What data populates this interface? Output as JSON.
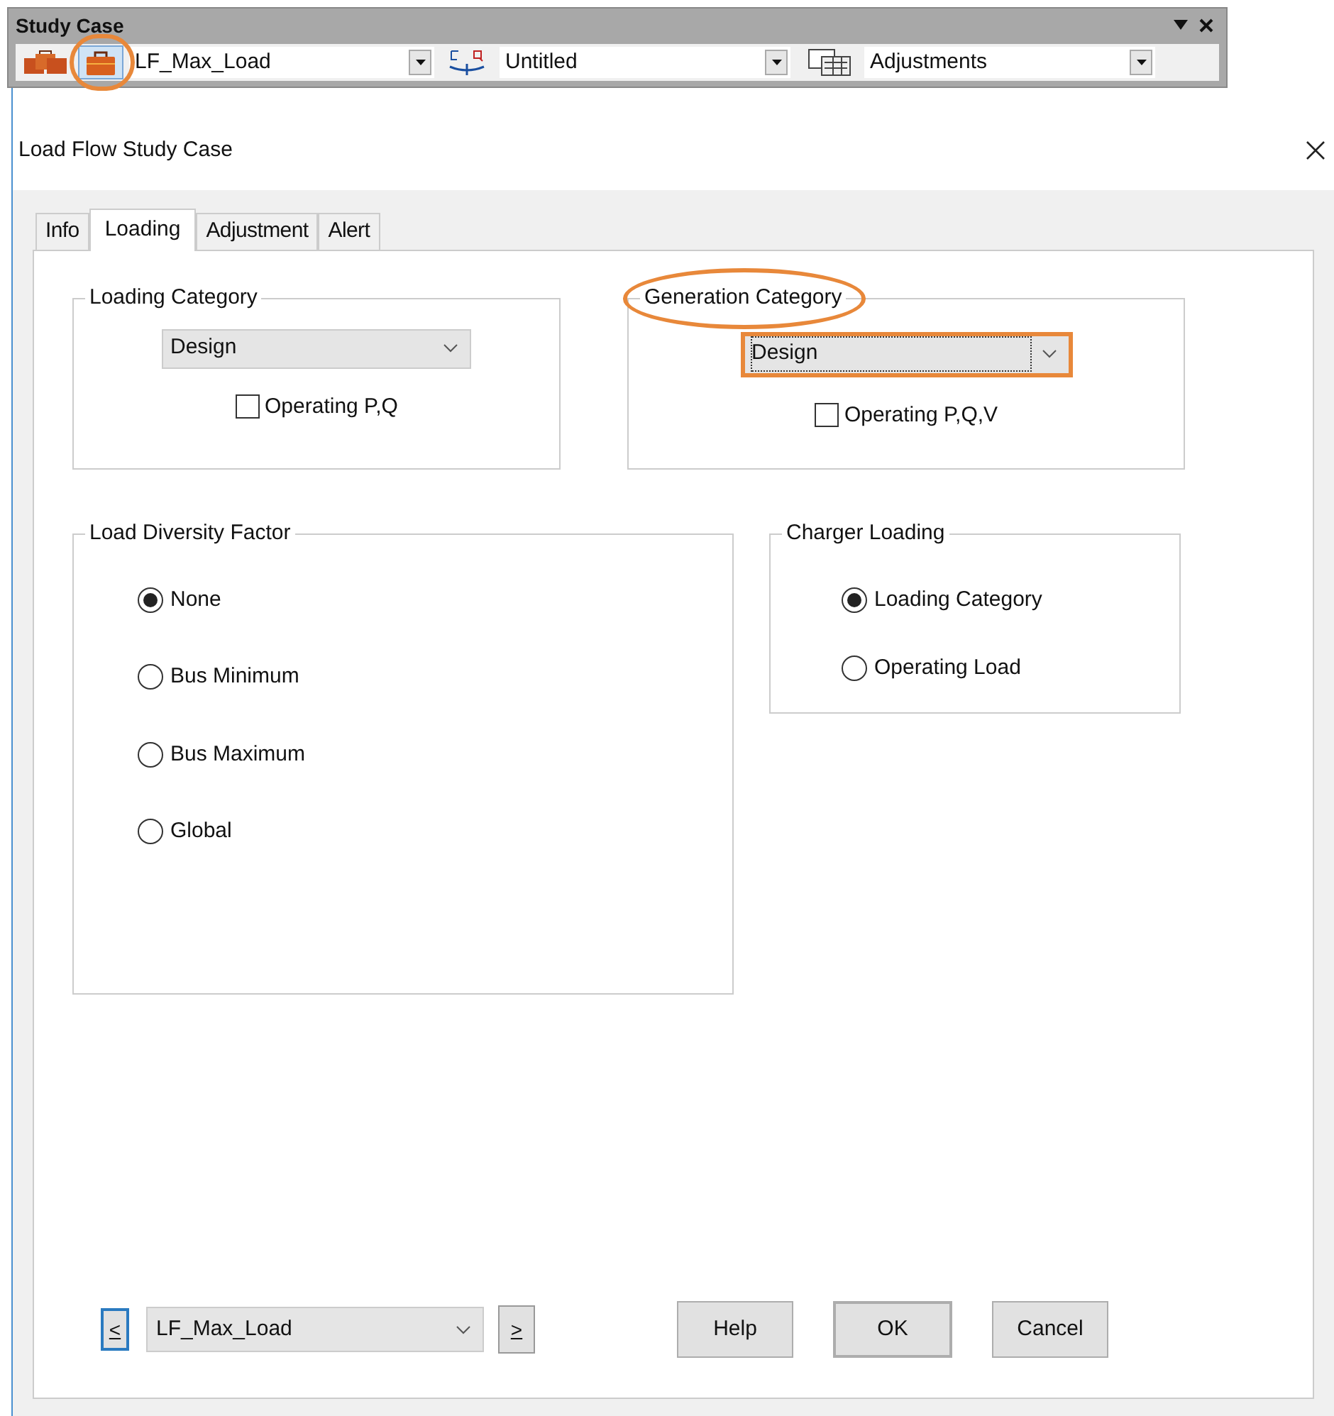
{
  "toolbar": {
    "title": "Study Case",
    "buttons": [
      {
        "kind": "cases",
        "highlighted": false
      },
      {
        "kind": "case",
        "highlighted": true
      }
    ],
    "combos": [
      {
        "kind": "case",
        "value": "LF_Max_Load"
      },
      {
        "kind": "pq",
        "value": "Untitled"
      },
      {
        "kind": "adjust",
        "value": "Adjustments"
      }
    ]
  },
  "dialog": {
    "title": "Load Flow Study Case",
    "tabs": [
      {
        "label": "Info",
        "selected": false
      },
      {
        "label": "Loading",
        "selected": true
      },
      {
        "label": "Adjustment",
        "selected": false
      },
      {
        "label": "Alert",
        "selected": false
      }
    ],
    "loading_category": {
      "title": "Loading Category",
      "highlighted": false,
      "dropdown": {
        "value": "Design",
        "highlighted": false
      },
      "checkbox": {
        "label": "Operating P,Q",
        "checked": false
      }
    },
    "generation_category": {
      "title": "Generation Category",
      "highlighted": true,
      "dropdown": {
        "value": "Design",
        "highlighted": true
      },
      "checkbox": {
        "label": "Operating P,Q,V",
        "checked": false
      }
    },
    "load_diversity_factor": {
      "title": "Load Diversity Factor",
      "options": [
        {
          "label": "None",
          "selected": true
        },
        {
          "label": "Bus Minimum",
          "selected": false
        },
        {
          "label": "Bus Maximum",
          "selected": false
        },
        {
          "label": "Global",
          "selected": false
        }
      ]
    },
    "charger_loading": {
      "title": "Charger Loading",
      "options": [
        {
          "label": "Loading Category",
          "selected": true
        },
        {
          "label": "Operating Load",
          "selected": false
        }
      ]
    },
    "footer": {
      "prev": "<",
      "case": "LF_Max_Load",
      "next": ">",
      "buttons": [
        "Help",
        "OK",
        "Cancel"
      ]
    }
  }
}
